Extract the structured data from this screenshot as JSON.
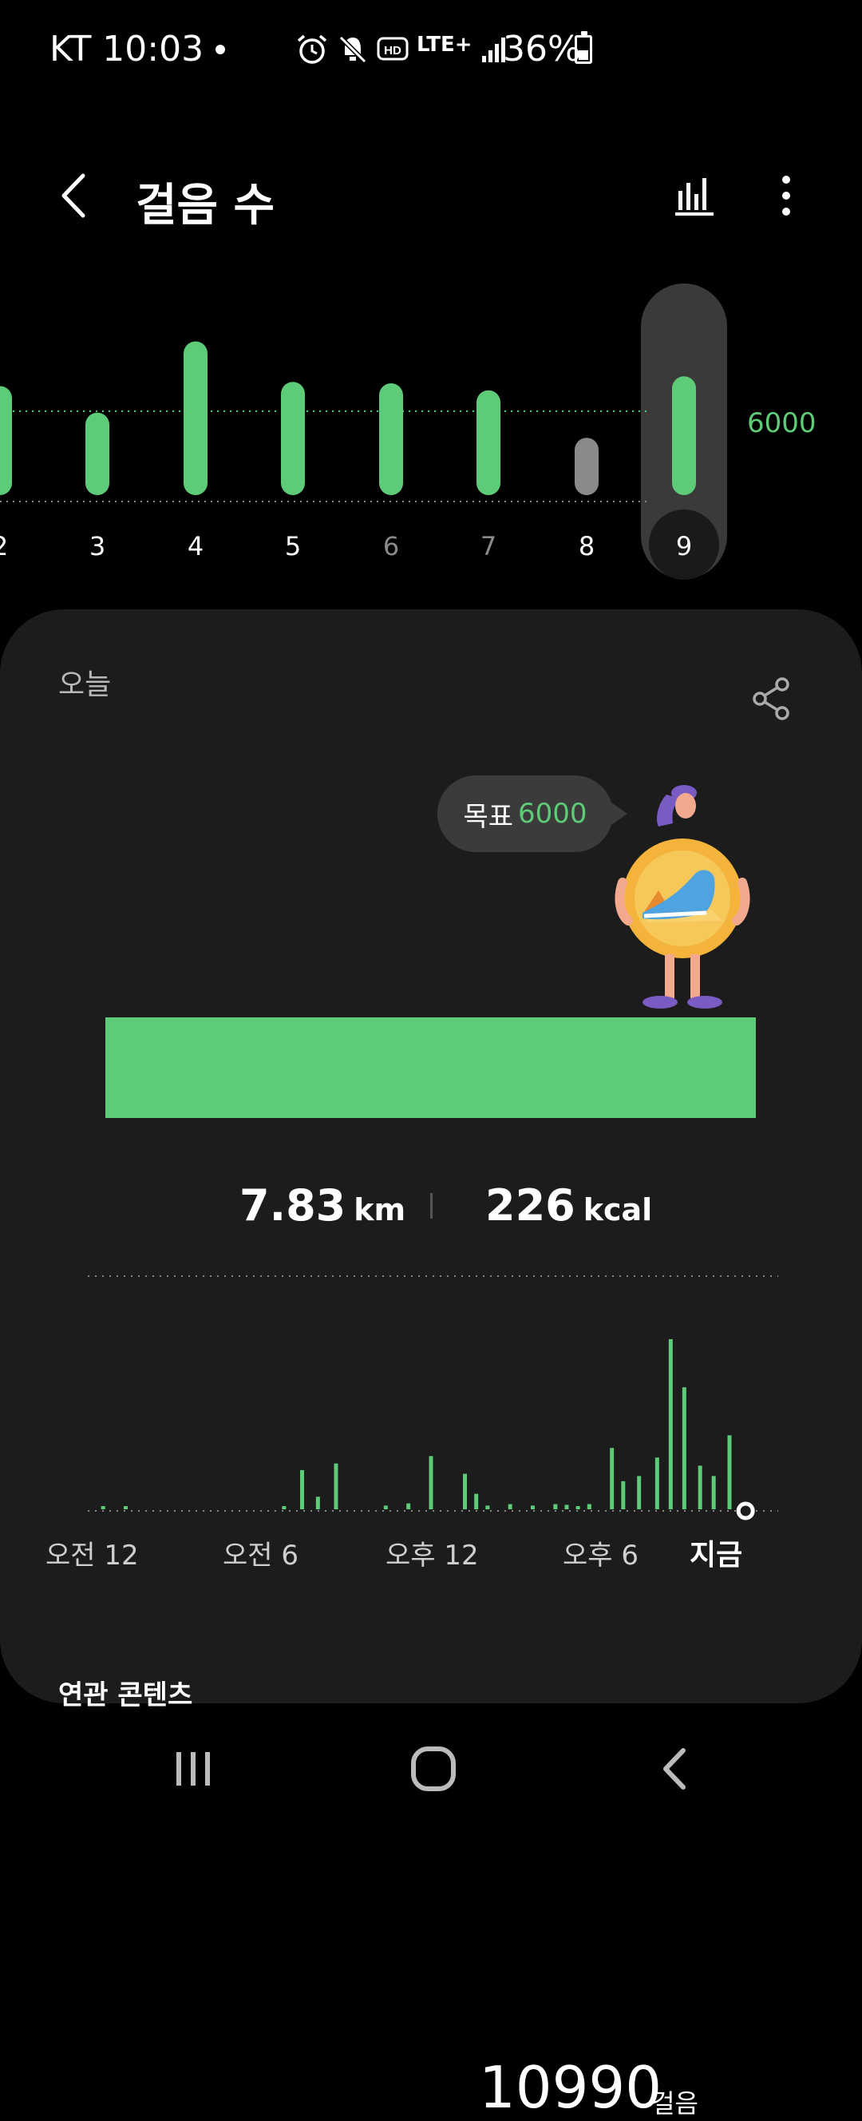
{
  "status_bar": {
    "carrier_time": "KT 10:03",
    "battery": "36%",
    "icons": [
      "alarm-icon",
      "mute-icon",
      "hd-icon",
      "lte-icon",
      "signal-icon",
      "battery-icon"
    ],
    "lte_label": "LTE+"
  },
  "app_bar": {
    "title": "걸음 수",
    "back_icon": "back-arrow-icon",
    "chart_icon": "bar-chart-icon",
    "more_icon": "more-vertical-icon"
  },
  "chart_data": [
    {
      "type": "bar",
      "categories": [
        "2",
        "3",
        "4",
        "5",
        "6",
        "7",
        "8",
        "9"
      ],
      "values": [
        7800,
        5900,
        11000,
        8100,
        8000,
        7500,
        4100,
        8500
      ],
      "goal": 6000,
      "goal_label": "6000",
      "selected": "9",
      "bar_colors": [
        "#5dcb77",
        "#5dcb77",
        "#5dcb77",
        "#5dcb77",
        "#5dcb77",
        "#5dcb77",
        "#8a8a8a",
        "#5dcb77"
      ],
      "label_colors": [
        "#ffffff",
        "#ffffff",
        "#ffffff",
        "#ffffff",
        "#8a8a8a",
        "#8a8a8a",
        "#ffffff",
        "#ffffff"
      ],
      "ylim": [
        0,
        12000
      ]
    },
    {
      "type": "bar",
      "title": "",
      "x_labels": [
        "오전 12",
        "오전 6",
        "오후 12",
        "오후 6",
        "지금"
      ],
      "hours": [
        0.5,
        1.5,
        8.5,
        9.3,
        10.0,
        10.8,
        13.0,
        14.0,
        15.0,
        16.5,
        17.0,
        17.5,
        18.5,
        19.5,
        20.5,
        21.0,
        21.5,
        22.0,
        23.0,
        23.5,
        24.2,
        25.0,
        25.6,
        26.2,
        26.9,
        27.5,
        28.2,
        28.7
      ],
      "values": [
        30,
        35,
        40,
        530,
        170,
        620,
        50,
        80,
        720,
        480,
        210,
        50,
        70,
        50,
        70,
        60,
        40,
        70,
        830,
        380,
        450,
        700,
        2300,
        1650,
        590,
        450,
        1000,
        20
      ],
      "now_hour": 28.7,
      "xlim": [
        0,
        30
      ],
      "ylim": [
        0,
        2300
      ]
    }
  ],
  "card": {
    "today_label": "오늘",
    "share_icon": "share-icon",
    "goal_prefix": "목표",
    "goal_value": "6000",
    "mascot": "mascot-illustration",
    "steps_value": "10990",
    "steps_unit": "걸음",
    "progress_fraction": 1.0,
    "distance_value": "7.83",
    "distance_unit": "km",
    "calories_value": "226",
    "calories_unit": "kcal",
    "related_title": "연관 콘텐츠"
  },
  "colors": {
    "accent": "#5dcb77",
    "background": "#000000",
    "card": "#1c1c1c",
    "bubble": "#3b3b3b"
  },
  "nav_bar": {
    "icons": [
      "recent-apps-icon",
      "home-icon",
      "back-icon"
    ]
  }
}
